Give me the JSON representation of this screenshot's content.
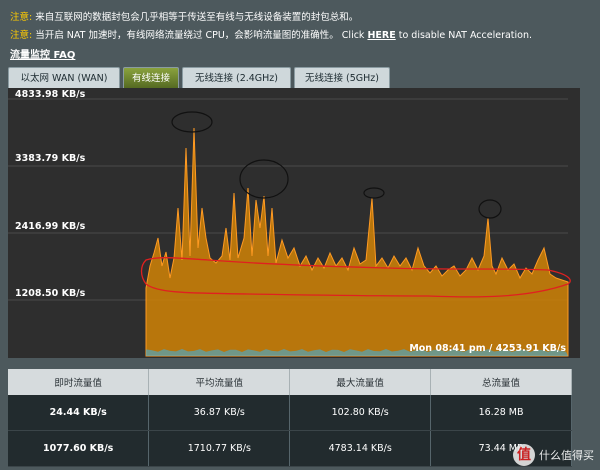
{
  "notices": [
    {
      "label": "注意:",
      "text": "来自互联网的数据封包会几乎相等于传送至有线与无线设备装置的封包总和。"
    },
    {
      "label": "注意:",
      "text": "当开启 NAT 加速时，有线网络流量绕过 CPU，会影响流量图的准确性。 Click ",
      "link": "HERE",
      "tail": " to disable NAT Acceleration."
    }
  ],
  "faq_link": "流量监控 FAQ",
  "tabs": [
    {
      "label": "以太网 WAN (WAN)",
      "active": false
    },
    {
      "label": "有线连接",
      "active": true
    },
    {
      "label": "无线连接 (2.4GHz)",
      "active": false
    },
    {
      "label": "无线连接 (5GHz)",
      "active": false
    }
  ],
  "graph": {
    "y_labels": [
      "4833.98 KB/s",
      "3383.79 KB/s",
      "2416.99 KB/s",
      "1208.50 KB/s"
    ],
    "current_readout": "Mon 08:41 pm / 4253.91 KB/s",
    "fill_color": "#c47d0a",
    "line_color": "#ff9a22",
    "rx_color": "#35b3ee"
  },
  "stats": {
    "headers": [
      "即时流量值",
      "平均流量值",
      "最大流量值",
      "总流量值"
    ],
    "rx_row": [
      "24.44 KB/s",
      "36.87 KB/s",
      "102.80 KB/s",
      "16.28 MB"
    ],
    "tx_row": [
      "1077.60 KB/s",
      "1710.77 KB/s",
      "4783.14 KB/s",
      "73.44 MB"
    ]
  },
  "watermark": {
    "glyph": "值",
    "text": "什么值得买"
  }
}
